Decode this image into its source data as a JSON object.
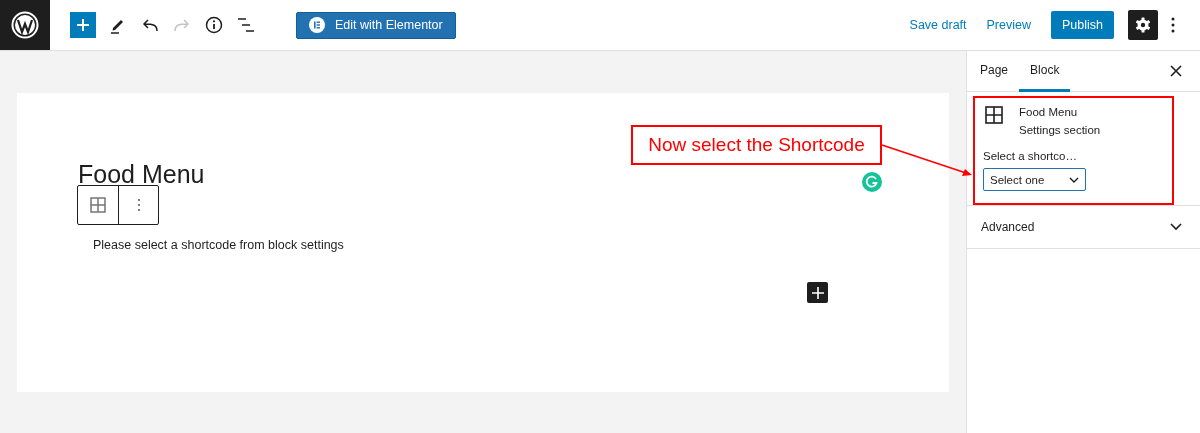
{
  "toolbar": {
    "tools": [
      {
        "kind": "add",
        "active": true
      },
      {
        "kind": "pen"
      },
      {
        "kind": "undo"
      },
      {
        "kind": "redo",
        "disabled": true
      },
      {
        "kind": "info"
      },
      {
        "kind": "outline"
      }
    ],
    "elementor_button": "Edit with Elementor",
    "save_draft": "Save draft",
    "preview": "Preview",
    "publish": "Publish",
    "settings": {
      "selected": true
    }
  },
  "editor": {
    "title": "Food Menu",
    "placeholder_text": "Please select a shortcode from block settings"
  },
  "annotation": {
    "text": "Now select the Shortcode"
  },
  "sidebar": {
    "tabs": [
      {
        "label": "Page",
        "selected": false
      },
      {
        "label": "Block",
        "selected": true
      }
    ],
    "block": {
      "name": "Food Menu",
      "description": "Settings section",
      "select_label": "Select a shortco…",
      "select_value": "Select one"
    },
    "panels": [
      {
        "title": "Advanced",
        "expanded": false
      }
    ]
  }
}
